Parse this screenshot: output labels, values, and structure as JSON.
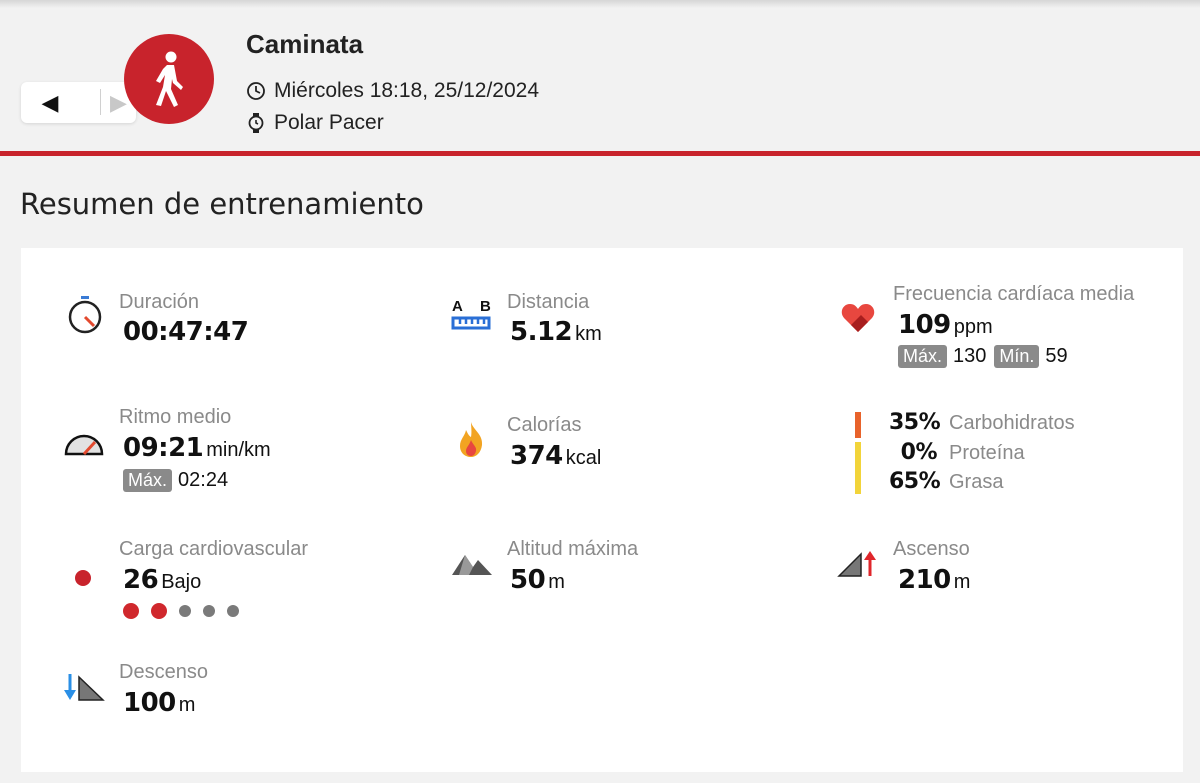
{
  "header": {
    "title": "Caminata",
    "datetime": "Miércoles 18:18, 25/12/2024",
    "device": "Polar Pacer",
    "nav_prev": "◀",
    "nav_next": "▶",
    "accent_color": "#c8232c"
  },
  "summary": {
    "title": "Resumen de entrenamiento",
    "duration": {
      "label": "Duración",
      "value": "00:47:47",
      "icon": "stopwatch-icon"
    },
    "distance": {
      "label": "Distancia",
      "value": "5.12",
      "unit": "km",
      "icon": "distance-ab-icon",
      "icon_text_a": "A",
      "icon_text_b": "B"
    },
    "heart_rate": {
      "label": "Frecuencia cardíaca media",
      "value": "109",
      "unit": "ppm",
      "max_label": "Máx.",
      "max_value": "130",
      "min_label": "Mín.",
      "min_value": "59",
      "icon": "heart-icon"
    },
    "pace": {
      "label": "Ritmo medio",
      "value": "09:21",
      "unit": "min/km",
      "max_label": "Máx.",
      "max_value": "02:24",
      "icon": "speedometer-icon"
    },
    "calories": {
      "label": "Calorías",
      "value": "374",
      "unit": "kcal",
      "icon": "flame-icon"
    },
    "nutrition": {
      "carbs": {
        "pct": "35%",
        "label": "Carbohidratos",
        "color": "#e8632b"
      },
      "protein": {
        "pct": "0%",
        "label": "Proteína",
        "color": "#f08a3c"
      },
      "fat": {
        "pct": "65%",
        "label": "Grasa",
        "color": "#f2d43a"
      }
    },
    "cardio_load": {
      "label": "Carga cardiovascular",
      "value": "26",
      "level": "Bajo",
      "filled_dots": 2,
      "total_dots": 5,
      "icon": "cardio-load-dot-icon"
    },
    "max_altitude": {
      "label": "Altitud máxima",
      "value": "50",
      "unit": "m",
      "icon": "mountain-icon"
    },
    "ascent": {
      "label": "Ascenso",
      "value": "210",
      "unit": "m",
      "icon": "ascent-icon"
    },
    "descent": {
      "label": "Descenso",
      "value": "100",
      "unit": "m",
      "icon": "descent-icon"
    }
  }
}
